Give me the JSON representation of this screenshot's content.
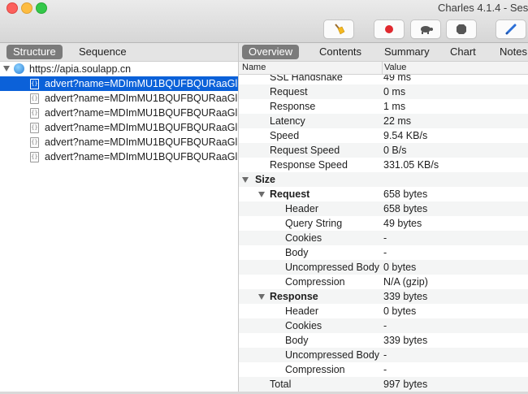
{
  "window": {
    "title": "Charles 4.1.4 - Ses"
  },
  "toolbar": {
    "buttons": [
      {
        "name": "broom-icon"
      },
      {
        "name": "record-icon",
        "color": "#e0282e"
      },
      {
        "name": "throttle-turtle-icon"
      },
      {
        "name": "stop-hexagon-icon"
      },
      {
        "name": "pen-edit-icon",
        "color": "#2c6fd6"
      }
    ]
  },
  "left_pane": {
    "tabs": [
      "Structure",
      "Sequence"
    ],
    "active_tab": "Structure",
    "host": "https://apia.soulapp.cn",
    "requests": [
      "advert?name=MDImMU1BQUFBQURaaGlLU2",
      "advert?name=MDImMU1BQUFBQURaaGlLU2",
      "advert?name=MDImMU1BQUFBQURaaGlLU2",
      "advert?name=MDImMU1BQUFBQURaaGlLU2",
      "advert?name=MDImMU1BQUFBQURaaGlLU2",
      "advert?name=MDImMU1BQUFBQURaaGlLU2"
    ],
    "selected_index": 0
  },
  "right_pane": {
    "tabs": [
      "Overview",
      "Contents",
      "Summary",
      "Chart",
      "Notes"
    ],
    "active_tab": "Overview",
    "columns": {
      "name": "Name",
      "value": "Value"
    },
    "rows": [
      {
        "name": "SSL Handshake",
        "value": "49 ms",
        "level": 1
      },
      {
        "name": "Request",
        "value": "0 ms",
        "level": 1
      },
      {
        "name": "Response",
        "value": "1 ms",
        "level": 1
      },
      {
        "name": "Latency",
        "value": "22 ms",
        "level": 1
      },
      {
        "name": "Speed",
        "value": "9.54 KB/s",
        "level": 1
      },
      {
        "name": "Request Speed",
        "value": "0 B/s",
        "level": 1
      },
      {
        "name": "Response Speed",
        "value": "331.05 KB/s",
        "level": 1
      },
      {
        "name": "Size",
        "value": "",
        "level": 0,
        "group": true
      },
      {
        "name": "Request",
        "value": "658 bytes",
        "level": 1,
        "group": true
      },
      {
        "name": "Header",
        "value": "658 bytes",
        "level": 2
      },
      {
        "name": "Query String",
        "value": "49 bytes",
        "level": 2
      },
      {
        "name": "Cookies",
        "value": "-",
        "level": 2
      },
      {
        "name": "Body",
        "value": "-",
        "level": 2
      },
      {
        "name": "Uncompressed Body",
        "value": "0 bytes",
        "level": 2
      },
      {
        "name": "Compression",
        "value": "N/A (gzip)",
        "level": 2
      },
      {
        "name": "Response",
        "value": "339 bytes",
        "level": 1,
        "group": true
      },
      {
        "name": "Header",
        "value": "0 bytes",
        "level": 2
      },
      {
        "name": "Cookies",
        "value": "-",
        "level": 2
      },
      {
        "name": "Body",
        "value": "339 bytes",
        "level": 2
      },
      {
        "name": "Uncompressed Body",
        "value": "-",
        "level": 2
      },
      {
        "name": "Compression",
        "value": "-",
        "level": 2
      },
      {
        "name": "Total",
        "value": "997 bytes",
        "level": 1
      }
    ]
  }
}
